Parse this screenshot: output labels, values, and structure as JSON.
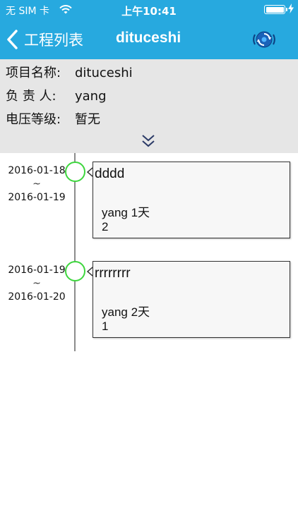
{
  "status_bar": {
    "carrier": "无 SIM 卡",
    "time": "上午10:41",
    "wifi_icon": "wifi-icon",
    "battery_icon": "battery-icon",
    "charging_icon": "bolt-icon"
  },
  "nav": {
    "back_label": "工程列表",
    "title": "dituceshi",
    "sync_icon": "sync-icon"
  },
  "project_info": {
    "name_label": "项目名称:",
    "name_value": "dituceshi",
    "owner_label": "负 责 人:",
    "owner_value": "yang",
    "voltage_label": "电压等级:",
    "voltage_value": "暂无",
    "expand_icon": "double-chevron-down-icon"
  },
  "timeline": [
    {
      "start_date": "2016-01-18",
      "separator": "~",
      "end_date": "2016-01-19",
      "title": "dddd",
      "person_duration": "yang 1天",
      "count": "2"
    },
    {
      "start_date": "2016-01-19",
      "separator": "~",
      "end_date": "2016-01-20",
      "title": "rrrrrrrr",
      "person_duration": "yang 2天",
      "count": "1"
    }
  ],
  "colors": {
    "accent": "#27a9df",
    "info_bg": "#e6e6e6",
    "node_ring": "#3ed63e",
    "timeline_line": "#8c8c8c"
  }
}
